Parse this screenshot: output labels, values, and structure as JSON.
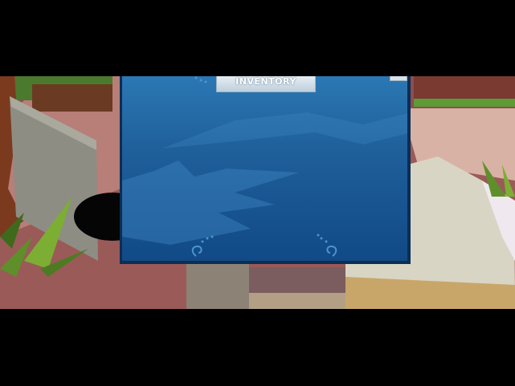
{
  "inventory_panel": {
    "title": "INVENTORY"
  },
  "icons": {
    "close": "close-icon",
    "swirl": "swirl-ornament-icon"
  },
  "colors": {
    "panel_top": "#2b78b4",
    "panel_bottom": "#114a86",
    "panel_border": "#0b2e55",
    "tab": "#d7e2ea",
    "letterbox": "#000000"
  }
}
